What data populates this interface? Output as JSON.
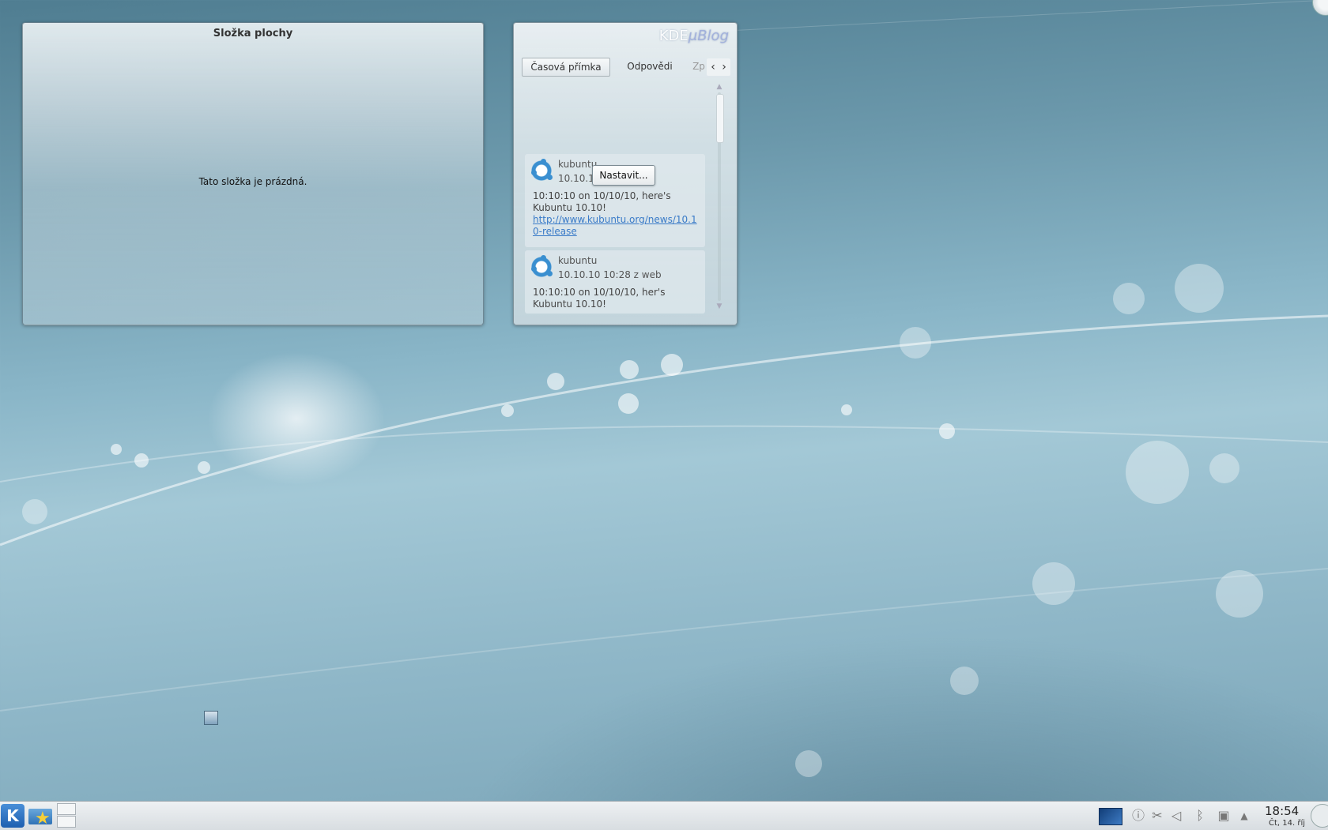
{
  "folder_view": {
    "title": "Složka plochy",
    "empty_message": "Tato složka je prázdná."
  },
  "microblog": {
    "logo_kde": "KDE",
    "logo_blog": "μBlog",
    "tabs": [
      "Časová přímka",
      "Odpovědi",
      "Zp"
    ],
    "configure_button": "Nastavit...",
    "posts": [
      {
        "user": "kubuntu",
        "time": "10.10.10",
        "text": "10:10:10 on 10/10/10, here's Kubuntu 10.10!",
        "link": "http://www.kubuntu.org/news/10.10-release"
      },
      {
        "user": "kubuntu",
        "time": "10.10.10 10:28 z web",
        "text": "10:10:10 on 10/10/10, her's Kubuntu 10.10!"
      }
    ]
  },
  "panel": {
    "kickoff_icon": "kde-logo-icon",
    "clock_time": "18:54",
    "clock_date": "Čt, 14. říj"
  },
  "colors": {
    "link": "#3a7bc8",
    "kickoff": "#1e5fb0"
  }
}
